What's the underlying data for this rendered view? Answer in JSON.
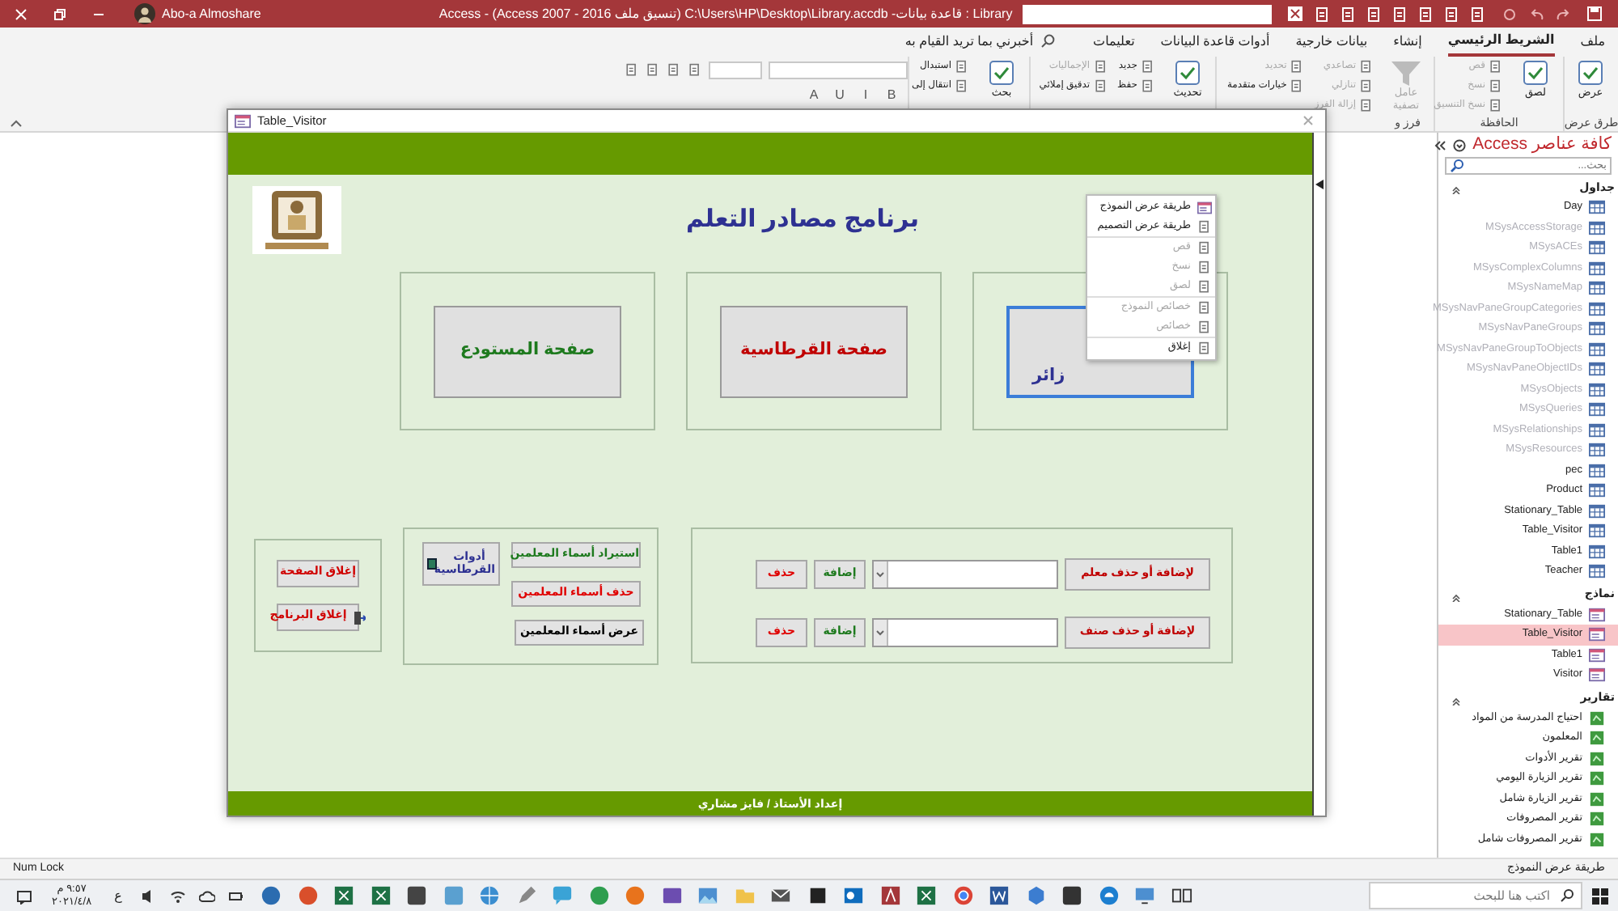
{
  "title_bar": {
    "user": "Abo-a Almoshare",
    "title": "Library : قاعدة بيانات- C:\\Users\\HP\\Desktop\\Library.accdb (تنسيق ملف Access 2007 - 2016) - Access"
  },
  "ribbon_tabs": [
    {
      "label": "ملف",
      "selected": false
    },
    {
      "label": "الشريط الرئيسي",
      "selected": true
    },
    {
      "label": "إنشاء",
      "selected": false
    },
    {
      "label": "بيانات خارجية",
      "selected": false
    },
    {
      "label": "أدوات قاعدة البيانات",
      "selected": false
    },
    {
      "label": "تعليمات",
      "selected": false
    }
  ],
  "tell_me": "أخبرني بما تريد القيام به",
  "ribbon_groups": [
    {
      "label": "طرق عرض",
      "columns": [
        [
          {
            "label": "عرض",
            "kind": "large",
            "disabled": false
          }
        ]
      ]
    },
    {
      "label": "الحافظة",
      "columns": [
        [
          {
            "label": "لصق",
            "kind": "large",
            "disabled": false
          }
        ],
        [
          {
            "label": "قص",
            "kind": "small",
            "disabled": true
          },
          {
            "label": "نسخ",
            "kind": "small",
            "disabled": true
          },
          {
            "label": "نسخ التنسيق",
            "kind": "small",
            "disabled": true
          }
        ]
      ]
    },
    {
      "label": "فرز و",
      "columns": [
        [
          {
            "label": "عامل تصفية",
            "kind": "large",
            "disabled": true
          }
        ],
        [
          {
            "label": "تصاعدي",
            "kind": "small",
            "disabled": true
          },
          {
            "label": "تنازلي",
            "kind": "small",
            "disabled": true
          },
          {
            "label": "إزالة الفرز",
            "kind": "small",
            "disabled": true
          }
        ],
        [
          {
            "label": "تحديد",
            "kind": "small",
            "disabled": true
          },
          {
            "label": "خيارات متقدمة",
            "kind": "small",
            "disabled": false
          }
        ]
      ]
    },
    {
      "columns": [
        [
          {
            "label": "تحديث",
            "kind": "large",
            "disabled": false
          }
        ],
        [
          {
            "label": "جديد",
            "kind": "small",
            "disabled": false
          },
          {
            "label": "حفظ",
            "kind": "small",
            "disabled": false
          }
        ],
        [
          {
            "label": "الإجماليات",
            "kind": "small",
            "disabled": true
          },
          {
            "label": "تدقيق إملائي",
            "kind": "small",
            "disabled": false
          }
        ]
      ]
    },
    {
      "columns": [
        [
          {
            "label": "بحث",
            "kind": "large",
            "disabled": false
          }
        ],
        [
          {
            "label": "استبدال",
            "kind": "small",
            "disabled": false
          },
          {
            "label": "انتقال إلى",
            "kind": "small",
            "disabled": false
          }
        ]
      ]
    }
  ],
  "format_buttons": [
    "B",
    "I",
    "U",
    "A"
  ],
  "form_window": {
    "title": "Table_Visitor",
    "heading": "برنامج مصادر التعلم",
    "page_buttons": [
      {
        "label": "زائر",
        "color": "#2e3192",
        "focused": true
      },
      {
        "label": "صفحة القرطاسية",
        "color": "#c00000",
        "focused": false
      },
      {
        "label": "صفحة المستودع",
        "color": "#1e7a1e",
        "focused": false
      }
    ],
    "close_buttons": [
      {
        "label": "إغلاق الصفحة",
        "kind": "plain"
      },
      {
        "label": "إغلاق البرنامج",
        "kind": "exit"
      }
    ],
    "tools_button": "أدوات القرطاسية",
    "teacher_buttons": [
      {
        "label": "استيراد أسماء المعلمين",
        "color": "#1e7a1e"
      },
      {
        "label": "حذف أسماء المعلمين",
        "color": "#e00000"
      },
      {
        "label": "عرض أسماء المعلمين",
        "color": "#000000"
      }
    ],
    "editors": [
      {
        "label": "لإضافة أو حذف معلم",
        "add": "إضافة",
        "delete": "حذف"
      },
      {
        "label": "لإضافة أو حذف صنف",
        "add": "إضافة",
        "delete": "حذف"
      }
    ],
    "footer": "إعداد الأستاذ / فايز مشاري",
    "context_menu": [
      [
        {
          "label": "طريقة عرض النموذج",
          "disabled": false
        },
        {
          "label": "طريقة عرض التصميم",
          "disabled": false
        }
      ],
      [
        {
          "label": "قص",
          "disabled": true
        },
        {
          "label": "نسخ",
          "disabled": true
        },
        {
          "label": "لصق",
          "disabled": true
        }
      ],
      [
        {
          "label": "خصائص النموذج",
          "disabled": true
        },
        {
          "label": "خصائص",
          "disabled": true
        }
      ],
      [
        {
          "label": "إغلاق",
          "disabled": false
        }
      ]
    ]
  },
  "nav_pane": {
    "title": "كافة عناصر Access",
    "search_placeholder": "بحث...",
    "groups": [
      {
        "label": "جداول",
        "expanded": true,
        "items": [
          {
            "label": "Day",
            "kind": "table",
            "system": false,
            "selected": false
          },
          {
            "label": "MSysAccessStorage",
            "kind": "table",
            "system": true,
            "selected": false
          },
          {
            "label": "MSysACEs",
            "kind": "table",
            "system": true,
            "selected": false
          },
          {
            "label": "MSysComplexColumns",
            "kind": "table",
            "system": true,
            "selected": false
          },
          {
            "label": "MSysNameMap",
            "kind": "table",
            "system": true,
            "selected": false
          },
          {
            "label": "MSysNavPaneGroupCategories",
            "kind": "table",
            "system": true,
            "selected": false
          },
          {
            "label": "MSysNavPaneGroups",
            "kind": "table",
            "system": true,
            "selected": false
          },
          {
            "label": "MSysNavPaneGroupToObjects",
            "kind": "table",
            "system": true,
            "selected": false
          },
          {
            "label": "MSysNavPaneObjectIDs",
            "kind": "table",
            "system": true,
            "selected": false
          },
          {
            "label": "MSysObjects",
            "kind": "table",
            "system": true,
            "selected": false
          },
          {
            "label": "MSysQueries",
            "kind": "table",
            "system": true,
            "selected": false
          },
          {
            "label": "MSysRelationships",
            "kind": "table",
            "system": true,
            "selected": false
          },
          {
            "label": "MSysResources",
            "kind": "table",
            "system": true,
            "selected": false
          },
          {
            "label": "pec",
            "kind": "table",
            "system": false,
            "selected": false
          },
          {
            "label": "Product",
            "kind": "table",
            "system": false,
            "selected": false
          },
          {
            "label": "Stationary_Table",
            "kind": "table",
            "system": false,
            "selected": false
          },
          {
            "label": "Table_Visitor",
            "kind": "table",
            "system": false,
            "selected": false
          },
          {
            "label": "Table1",
            "kind": "table",
            "system": false,
            "selected": false
          },
          {
            "label": "Teacher",
            "kind": "table",
            "system": false,
            "selected": false
          }
        ]
      },
      {
        "label": "نماذج",
        "expanded": true,
        "items": [
          {
            "label": "Stationary_Table",
            "kind": "form",
            "system": false,
            "selected": false
          },
          {
            "label": "Table_Visitor",
            "kind": "form",
            "system": false,
            "selected": true
          },
          {
            "label": "Table1",
            "kind": "form",
            "system": false,
            "selected": false
          },
          {
            "label": "Visitor",
            "kind": "form",
            "system": false,
            "selected": false
          }
        ]
      },
      {
        "label": "تقارير",
        "expanded": true,
        "items": [
          {
            "label": "احتياج المدرسة من المواد",
            "kind": "report",
            "system": false,
            "selected": false
          },
          {
            "label": "المعلمون",
            "kind": "report",
            "system": false,
            "selected": false
          },
          {
            "label": "تقرير الأدوات",
            "kind": "report",
            "system": false,
            "selected": false
          },
          {
            "label": "تقرير الزيارة اليومي",
            "kind": "report",
            "system": false,
            "selected": false
          },
          {
            "label": "تقرير الزيارة شامل",
            "kind": "report",
            "system": false,
            "selected": false
          },
          {
            "label": "تقرير المصروفات",
            "kind": "report",
            "system": false,
            "selected": false
          },
          {
            "label": "تقرير المصروفات شامل",
            "kind": "report",
            "system": false,
            "selected": false
          }
        ]
      }
    ]
  },
  "status_bar": {
    "left": "Num Lock",
    "right": "طريقة عرض النموذج"
  },
  "taskbar": {
    "search_placeholder": "اكتب هنا للبحث",
    "time": "٩:٥٧ م",
    "date": "٢٠٢١/٤/٨",
    "language": "ع"
  }
}
